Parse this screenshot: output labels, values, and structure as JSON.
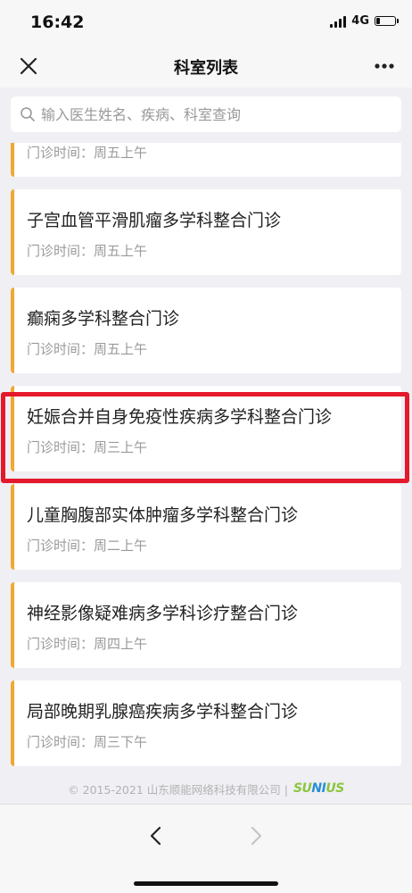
{
  "status": {
    "time": "16:42",
    "network": "4G",
    "battery_level": 0.2
  },
  "nav": {
    "title": "科室列表"
  },
  "search": {
    "placeholder": "输入医生姓名、疾病、科室查询"
  },
  "departments": [
    {
      "name": "",
      "time": "门诊时间：周五上午"
    },
    {
      "name": "子宫血管平滑肌瘤多学科整合门诊",
      "time": "门诊时间：周五上午"
    },
    {
      "name": "癫痫多学科整合门诊",
      "time": "门诊时间：周五上午"
    },
    {
      "name": "妊娠合并自身免疫性疾病多学科整合门诊",
      "time": "门诊时间：周三上午"
    },
    {
      "name": "儿童胸腹部实体肿瘤多学科整合门诊",
      "time": "门诊时间：周二上午"
    },
    {
      "name": "神经影像疑难病多学科诊疗整合门诊",
      "time": "门诊时间：周四上午"
    },
    {
      "name": "局部晚期乳腺癌疾病多学科整合门诊",
      "time": "门诊时间：周三下午"
    }
  ],
  "footer": {
    "copyright": "© 2015-2021 山东顺能网络科技有限公司 |",
    "logo": "SUNIUS"
  },
  "colors": {
    "accent": "#f0a830",
    "highlight": "#e4192b",
    "logo_green": "#8cc63f",
    "logo_blue": "#2a8fd6"
  },
  "icons": {
    "close": "close-icon",
    "more": "more-icon",
    "search": "search-icon",
    "back": "chevron-left-icon",
    "forward": "chevron-right-icon"
  }
}
